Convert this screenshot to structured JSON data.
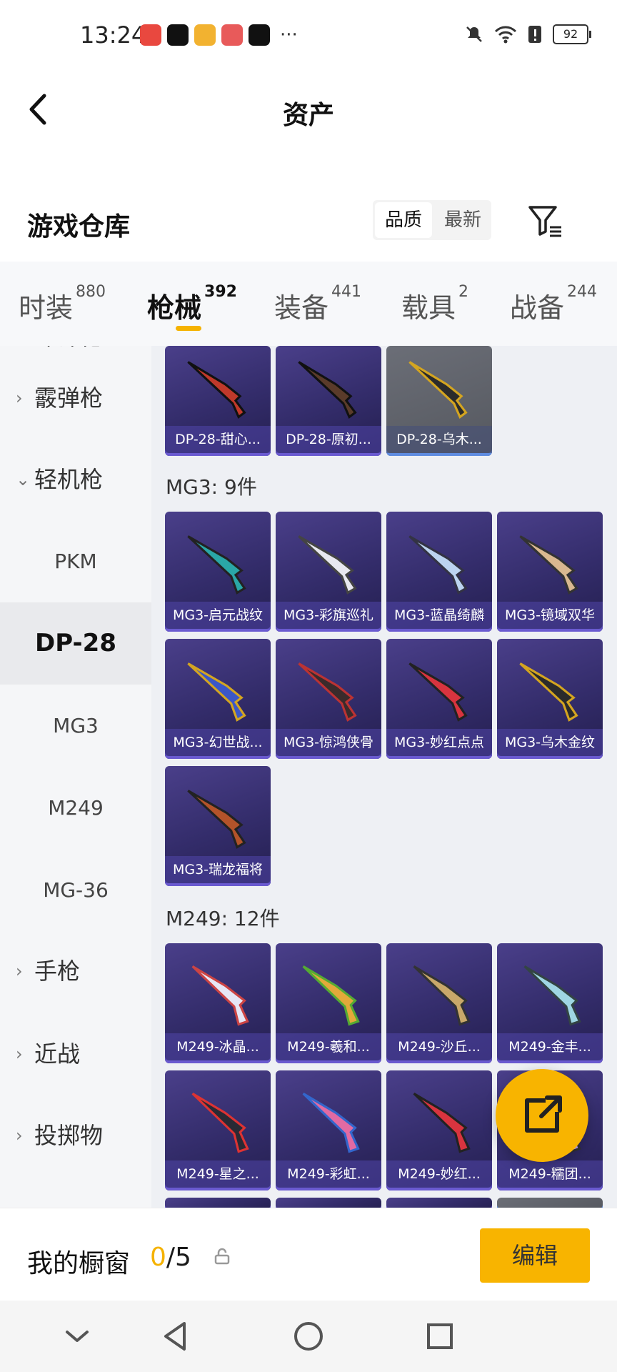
{
  "status_bar": {
    "time": "13:24",
    "more": "···",
    "battery": "92"
  },
  "header": {
    "title": "资产"
  },
  "warehouse": {
    "title": "游戏仓库",
    "sort_quality": "品质",
    "sort_newest": "最新"
  },
  "tabs": [
    {
      "label": "时装",
      "count": "880"
    },
    {
      "label": "枪械",
      "count": "392"
    },
    {
      "label": "装备",
      "count": "441"
    },
    {
      "label": "载具",
      "count": "2"
    },
    {
      "label": "战备",
      "count": "244"
    }
  ],
  "sidebar": {
    "partial": "冲锋枪",
    "shotgun": "霰弹枪",
    "lmg": "轻机枪",
    "subs": [
      "PKM",
      "DP-28",
      "MG3",
      "M249",
      "MG-36"
    ],
    "pistol": "手枪",
    "melee": "近战",
    "throwable": "投掷物"
  },
  "groups": {
    "mg3": "MG3: 9件",
    "m249": "M249: 12件"
  },
  "dp28_items": [
    "DP-28-甜心...",
    "DP-28-原初...",
    "DP-28-乌木..."
  ],
  "mg3_items": [
    "MG3-启元战纹",
    "MG3-彩旗巡礼",
    "MG3-蓝晶绮麟",
    "MG3-镜域双华",
    "MG3-幻世战...",
    "MG3-惊鸿侠骨",
    "MG3-妙红点点",
    "MG3-乌木金纹",
    "MG3-瑞龙福将"
  ],
  "m249_items": [
    "M249-冰晶...",
    "M249-羲和...",
    "M249-沙丘...",
    "M249-金丰...",
    "M249-星之...",
    "M249-彩虹...",
    "M249-妙红...",
    "M249-糯团..."
  ],
  "showcase": {
    "label": "我的橱窗",
    "count": "0",
    "total": "/5",
    "edit": "编辑"
  },
  "colors": {
    "accent": "#f8b400",
    "card_purple": "#332c6a"
  }
}
